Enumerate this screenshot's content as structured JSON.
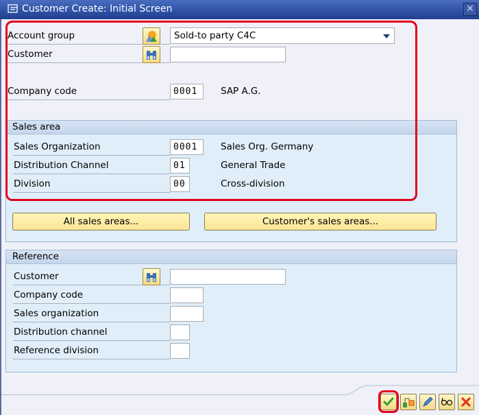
{
  "window": {
    "title": "Customer Create: Initial Screen",
    "close_label": "✕"
  },
  "main": {
    "account_group": {
      "label": "Account group",
      "value": "Sold-to party C4C"
    },
    "customer": {
      "label": "Customer",
      "value": ""
    },
    "company_code": {
      "label": "Company code",
      "value": "0001",
      "description": "SAP A.G."
    }
  },
  "sales_area": {
    "title": "Sales area",
    "rows": [
      {
        "label": "Sales Organization",
        "value": "0001",
        "description": "Sales Org. Germany"
      },
      {
        "label": "Distribution Channel",
        "value": "01",
        "description": "General Trade"
      },
      {
        "label": "Division",
        "value": "00",
        "description": "Cross-division"
      }
    ],
    "buttons": {
      "all_sales_areas": "All sales areas...",
      "customers_sales_areas": "Customer's sales areas..."
    }
  },
  "reference": {
    "title": "Reference",
    "rows": [
      {
        "label": "Customer",
        "value": ""
      },
      {
        "label": "Company code",
        "value": ""
      },
      {
        "label": "Sales organization",
        "value": ""
      },
      {
        "label": "Distribution channel",
        "value": ""
      },
      {
        "label": "Reference division",
        "value": ""
      }
    ]
  },
  "toolbar": {
    "buttons": [
      {
        "name": "enter",
        "icon": "checkmark-icon"
      },
      {
        "name": "org-levels",
        "icon": "hierarchy-icon"
      },
      {
        "name": "edit",
        "icon": "pencil-icon"
      },
      {
        "name": "glasses",
        "icon": "glasses-icon"
      },
      {
        "name": "cancel",
        "icon": "cancel-x-icon"
      }
    ]
  },
  "colors": {
    "highlight": "#e3001b",
    "titlebar": "#3358ad",
    "group_bg": "#dfeef8",
    "button_bg": "#fbe596"
  }
}
